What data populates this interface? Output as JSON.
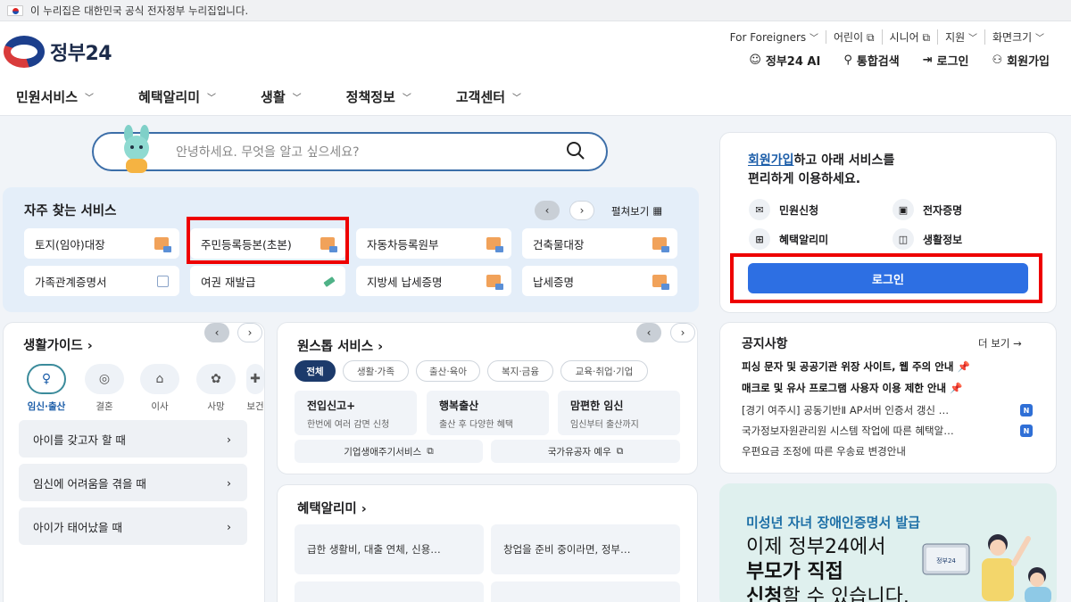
{
  "gov_banner": {
    "text": "이 누리집은 대한민국 공식 전자정부 누리집입니다."
  },
  "header": {
    "logo_text": "정부24",
    "util_links": [
      {
        "label": "For Foreigners",
        "icon": "chevron-down-icon"
      },
      {
        "label": "어린이",
        "icon": "external-link-icon"
      },
      {
        "label": "시니어",
        "icon": "external-link-icon"
      },
      {
        "label": "지원",
        "icon": "chevron-down-icon"
      },
      {
        "label": "화면크기",
        "icon": "chevron-down-icon"
      }
    ],
    "actions": [
      {
        "label": "정부24 AI",
        "icon": "robot-icon"
      },
      {
        "label": "통합검색",
        "icon": "search-icon"
      },
      {
        "label": "로그인",
        "icon": "login-icon"
      },
      {
        "label": "회원가입",
        "icon": "user-add-icon"
      }
    ],
    "gnb": [
      "민원서비스",
      "혜택알리미",
      "생활",
      "정책정보",
      "고객센터"
    ]
  },
  "search": {
    "placeholder": "안녕하세요. 무엇을 알고 싶으세요?"
  },
  "frequent": {
    "title": "자주 찾는 서비스",
    "expand_label": "펼쳐보기",
    "tiles": [
      {
        "label": "토지(임야)대장",
        "icon": "document-icon"
      },
      {
        "label": "주민등록등본(초본)",
        "icon": "document-icon"
      },
      {
        "label": "자동차등록원부",
        "icon": "document-icon"
      },
      {
        "label": "건축물대장",
        "icon": "document-icon"
      },
      {
        "label": "가족관계증명서",
        "icon": "external-link-icon"
      },
      {
        "label": "여권 재발급",
        "icon": "pen-icon"
      },
      {
        "label": "지방세 납세증명",
        "icon": "document-icon"
      },
      {
        "label": "납세증명",
        "icon": "document-icon"
      }
    ]
  },
  "guide": {
    "title": "생활가이드",
    "categories": [
      {
        "label": "임신·출산",
        "icon": "pregnancy-icon"
      },
      {
        "label": "결혼",
        "icon": "rings-icon"
      },
      {
        "label": "이사",
        "icon": "house-icon"
      },
      {
        "label": "사망",
        "icon": "flower-icon"
      },
      {
        "label": "보건",
        "icon": "health-icon"
      }
    ],
    "items": [
      "아이를 갖고자 할 때",
      "임신에 어려움을 겪을 때",
      "아이가 태어났을 때"
    ]
  },
  "onestop": {
    "title": "원스톱 서비스",
    "chips": [
      "전체",
      "생활·가족",
      "출산·육아",
      "복지·금융",
      "교육·취업·기업"
    ],
    "boxes": [
      {
        "title": "전입신고+",
        "sub": "한번에 여러 감면 신청"
      },
      {
        "title": "행복출산",
        "sub": "출산 후 다양한 혜택"
      },
      {
        "title": "맘편한 임신",
        "sub": "임신부터 출산까지"
      }
    ],
    "links": [
      "기업생애주기서비스",
      "국가유공자 예우"
    ]
  },
  "benefit": {
    "title": "혜택알리미",
    "boxes": [
      "급한 생활비, 대출 연체, 신용…",
      "창업을 준비 중이라면, 정부…"
    ]
  },
  "login_card": {
    "signup_link": "회원가입",
    "text_rest": "하고 아래 서비스를",
    "text_line2": "편리하게 이용하세요.",
    "services": [
      {
        "label": "민원신청",
        "icon": "mail-icon"
      },
      {
        "label": "전자증명",
        "icon": "certificate-icon"
      },
      {
        "label": "혜택알리미",
        "icon": "gift-icon"
      },
      {
        "label": "생활정보",
        "icon": "info-card-icon"
      }
    ],
    "login_button": "로그인"
  },
  "notice": {
    "title": "공지사항",
    "more": "더 보기",
    "items": [
      {
        "text": "피싱 문자 및 공공기관 위장 사이트, 웹 주의 안내",
        "bold": true,
        "pinned": true
      },
      {
        "text": "매크로 및 유사 프로그램 사용자 이용 제한 안내",
        "bold": true,
        "pinned": true
      },
      {
        "text": "[경기 여주시] 공동기반Ⅱ AP서버 인증서 갱신 …",
        "new": "N"
      },
      {
        "text": "국가정보자원관리원 시스템 작업에 따른 혜택알…",
        "new": "N"
      },
      {
        "text": "우편요금 조정에 따른 우송료 변경안내"
      }
    ]
  },
  "promo": {
    "subtitle": "미성년 자녀 장애인증명서 발급",
    "line1": "이제 정부24에서",
    "line2": "부모가 직접",
    "line3_bold": "신청",
    "line3_rest": "할 수 있습니다.",
    "device_label": "정부24"
  },
  "colors": {
    "primary": "#2d6fe3",
    "highlight": "#e00000",
    "navy": "#1c3a6b",
    "freq_bg": "#e4eef9"
  }
}
